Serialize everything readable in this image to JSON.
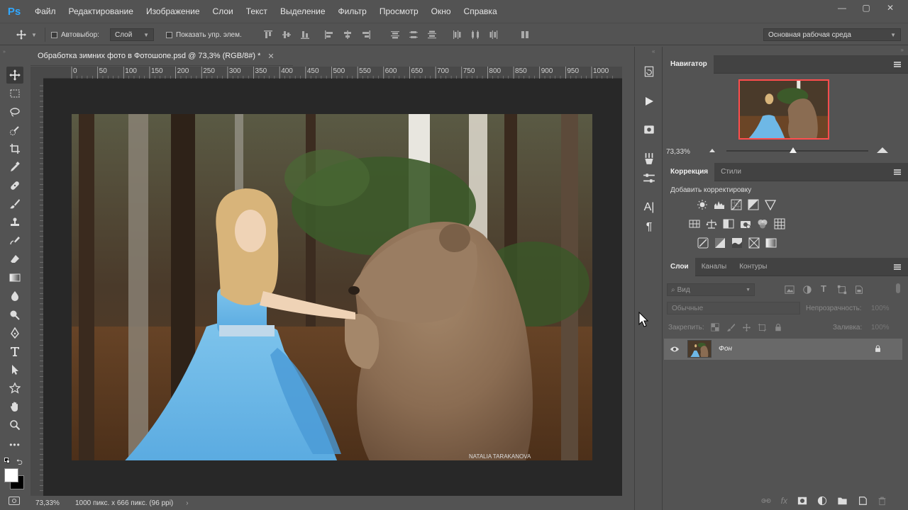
{
  "app": {
    "logo": "Ps"
  },
  "menu": [
    "Файл",
    "Редактирование",
    "Изображение",
    "Слои",
    "Текст",
    "Выделение",
    "Фильтр",
    "Просмотр",
    "Окно",
    "Справка"
  ],
  "window_controls": {
    "minimize": "—",
    "maximize": "▢",
    "close": "✕"
  },
  "options": {
    "autoselect_label": "Автовыбор:",
    "autoselect_value": "Слой",
    "show_controls_label": "Показать упр. элем.",
    "workspace": "Основная рабочая среда"
  },
  "document": {
    "tab_title": "Обработка зимних фото в Фотошопе.psd @ 73,3% (RGB/8#) *",
    "close_glyph": "✕",
    "ruler_ticks": [
      "0",
      "50",
      "100",
      "150",
      "200",
      "250",
      "300",
      "350",
      "400",
      "450",
      "500",
      "550",
      "600",
      "650",
      "700",
      "750",
      "800",
      "850",
      "900",
      "950",
      "1000"
    ],
    "watermark": "NATALIA TARAKANOVA",
    "zoom": "73,33%",
    "size_info": "1000 пикс. x 666 пикс. (96 ppi)"
  },
  "navigator": {
    "title": "Навигатор",
    "zoom": "73,33%",
    "zoom_level": 0.47
  },
  "adjustments": {
    "tabs": [
      "Коррекция",
      "Стили"
    ],
    "hint": "Добавить корректировку"
  },
  "layers": {
    "tabs": [
      "Слои",
      "Каналы",
      "Контуры"
    ],
    "filter_placeholder": "Вид",
    "blend_mode": "Обычные",
    "opacity_label": "Непрозрачность:",
    "opacity_value": "100%",
    "lock_label": "Закрепить:",
    "fill_label": "Заливка:",
    "fill_value": "100%",
    "items": [
      {
        "name": "Фон"
      }
    ]
  },
  "colors": {
    "accent_blue": "#31a8ff",
    "nav_frame": "#ff4d4d",
    "canvas_bg": "#282828",
    "panel_bg": "#535353"
  }
}
